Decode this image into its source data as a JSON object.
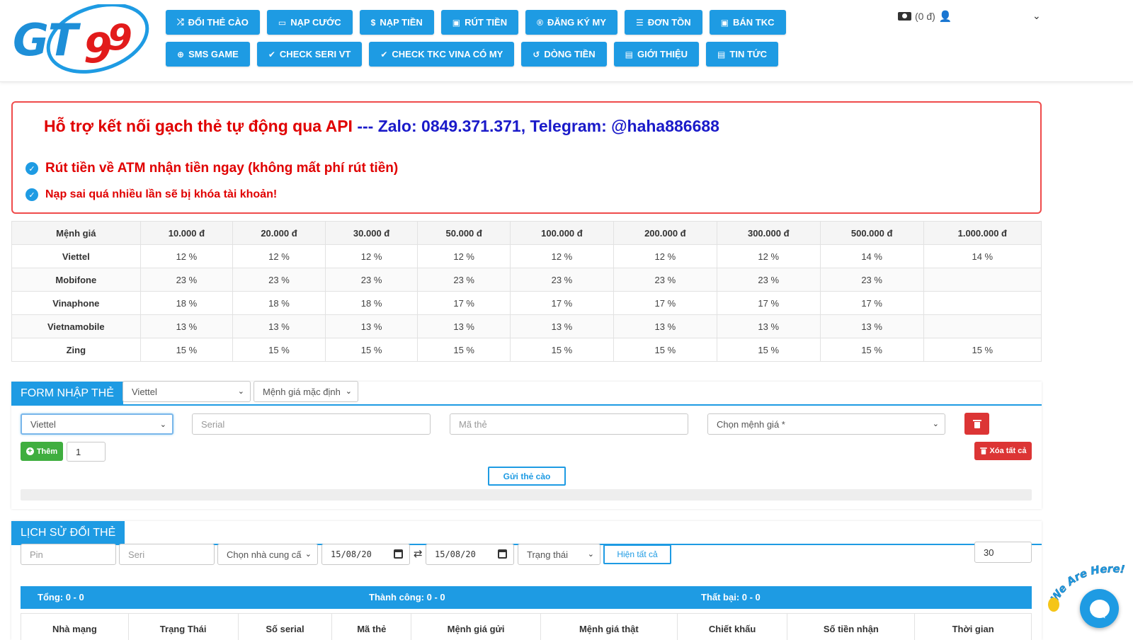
{
  "header": {
    "logo_text": "GT99",
    "nav_row1": [
      {
        "icon": "shuffle-icon",
        "glyph": "⤮",
        "label": "ĐỔI THẺ CÀO"
      },
      {
        "icon": "credit-card-icon",
        "glyph": "▭",
        "label": "NẠP CƯỚC"
      },
      {
        "icon": "dollar-icon",
        "glyph": "$",
        "label": "NẠP TIỀN"
      },
      {
        "icon": "money-icon",
        "glyph": "▣",
        "label": "RÚT TIỀN"
      },
      {
        "icon": "registered-icon",
        "glyph": "®",
        "label": "ĐĂNG KÝ MY"
      },
      {
        "icon": "list-icon",
        "glyph": "☰",
        "label": "ĐƠN TỒN"
      },
      {
        "icon": "money-icon",
        "glyph": "▣",
        "label": "BÁN TKC"
      }
    ],
    "nav_row2": [
      {
        "icon": "gamepad-icon",
        "glyph": "⊕",
        "label": "SMS GAME"
      },
      {
        "icon": "check-icon",
        "glyph": "✔",
        "label": "CHECK SERI VT"
      },
      {
        "icon": "check-icon",
        "glyph": "✔",
        "label": "CHECK TKC VINA CÓ MY"
      },
      {
        "icon": "history-icon",
        "glyph": "↺",
        "label": "DÒNG TIỀN"
      },
      {
        "icon": "newspaper-icon",
        "glyph": "▤",
        "label": "GIỚI THIỆU"
      },
      {
        "icon": "newspaper-icon",
        "glyph": "▤",
        "label": "TIN TỨC"
      }
    ],
    "balance": "(0 đ)"
  },
  "notice": {
    "title_red": "Hỗ trợ kết nối gạch thẻ tự động qua API",
    "title_sep": " --- ",
    "title_blue": "Zalo: 0849.371.371, Telegram: @haha886688",
    "line1": "Rút tiền về ATM nhận tiền ngay (không mất phí rút tiền)",
    "line2": "Nạp sai quá nhiều lần sẽ bị khóa tài khoản!"
  },
  "rates": {
    "headers": [
      "Mệnh giá",
      "10.000 đ",
      "20.000 đ",
      "30.000 đ",
      "50.000 đ",
      "100.000 đ",
      "200.000 đ",
      "300.000 đ",
      "500.000 đ",
      "1.000.000 đ"
    ],
    "rows": [
      [
        "Viettel",
        "12 %",
        "12 %",
        "12 %",
        "12 %",
        "12 %",
        "12 %",
        "12 %",
        "14 %",
        "14 %"
      ],
      [
        "Mobifone",
        "23 %",
        "23 %",
        "23 %",
        "23 %",
        "23 %",
        "23 %",
        "23 %",
        "23 %",
        ""
      ],
      [
        "Vinaphone",
        "18 %",
        "18 %",
        "18 %",
        "17 %",
        "17 %",
        "17 %",
        "17 %",
        "17 %",
        ""
      ],
      [
        "Vietnamobile",
        "13 %",
        "13 %",
        "13 %",
        "13 %",
        "13 %",
        "13 %",
        "13 %",
        "13 %",
        ""
      ],
      [
        "Zing",
        "15 %",
        "15 %",
        "15 %",
        "15 %",
        "15 %",
        "15 %",
        "15 %",
        "15 %",
        "15 %"
      ]
    ]
  },
  "form": {
    "title": "FORM NHẬP THẺ",
    "head_telco": "Viettel",
    "head_amount": "Mệnh giá mặc định",
    "row_telco": "Viettel",
    "serial_placeholder": "Serial",
    "code_placeholder": "Mã thẻ",
    "amount_placeholder": "Chọn mệnh giá *",
    "add_label": "Thêm",
    "count_value": "1",
    "clear_label": "Xóa tất cả",
    "submit_label": "Gửi thẻ cào"
  },
  "history": {
    "title": "LỊCH SỬ ĐỔI THẺ",
    "pin_placeholder": "Pin",
    "seri_placeholder": "Seri",
    "provider_placeholder": "Chọn nhà cung cấ",
    "date_from": "15/08/20",
    "date_to": "15/08/20",
    "status_placeholder": "Trạng thái",
    "show_all_label": "Hiện tất cả",
    "page_size": "30",
    "total": "Tổng: 0 - 0",
    "success": "Thành công: 0 - 0",
    "failed": "Thất bại: 0 - 0",
    "columns": [
      "Nhà mạng",
      "Trạng Thái",
      "Số serial",
      "Mã thẻ",
      "Mệnh giá gửi",
      "Mệnh giá thật",
      "Chiết khấu",
      "Số tiền nhận",
      "Thời gian"
    ]
  },
  "chat": {
    "badge_text": "We Are Here!"
  },
  "colors": {
    "primary": "#1e9be3",
    "danger": "#dc3535",
    "success": "#3fae3f",
    "notice_red": "#e00000",
    "notice_blue": "#1a1ac9"
  }
}
